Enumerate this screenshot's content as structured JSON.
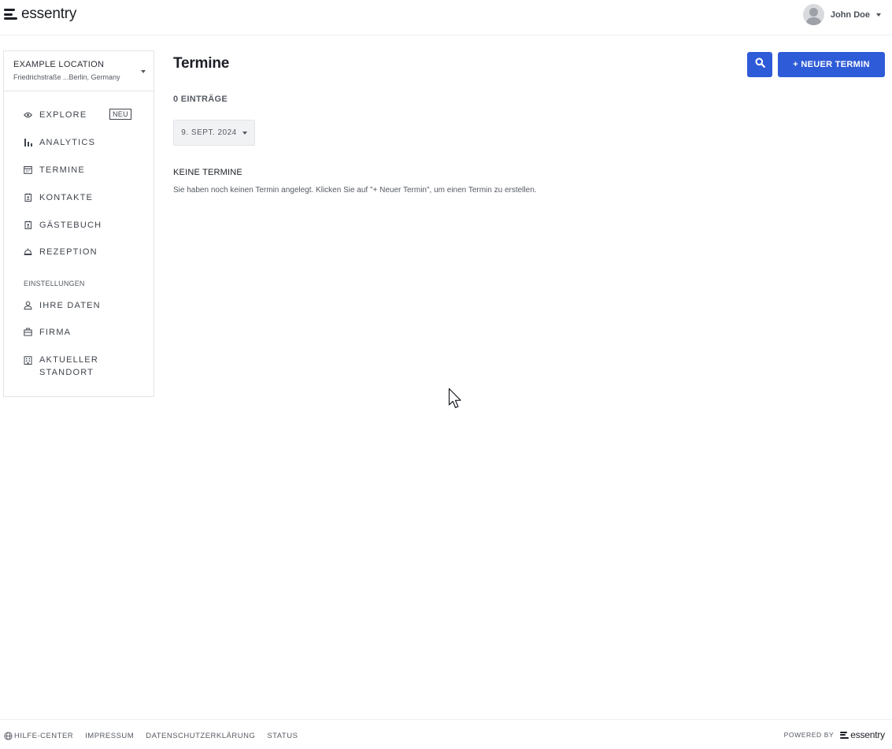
{
  "header": {
    "brand": "essentry",
    "user_name": "John Doe"
  },
  "location": {
    "name": "EXAMPLE LOCATION",
    "address": "Friedrichstraße ...Berlin, Germany"
  },
  "sidebar": {
    "items": [
      {
        "label": "EXPLORE",
        "icon": "eye-icon"
      },
      {
        "label": "ANALYTICS",
        "icon": "bar-chart-icon"
      },
      {
        "label": "TERMINE",
        "icon": "calendar-icon"
      },
      {
        "label": "KONTAKTE",
        "icon": "contact-book-icon"
      },
      {
        "label": "GÄSTEBUCH",
        "icon": "guestbook-icon"
      },
      {
        "label": "REZEPTION",
        "icon": "reception-bell-icon"
      }
    ],
    "new_badge": "NEU",
    "settings_label": "EINSTELLUNGEN",
    "settings_items": [
      {
        "label": "IHRE DATEN",
        "icon": "person-icon"
      },
      {
        "label": "FIRMA",
        "icon": "briefcase-icon"
      },
      {
        "label_line1": "AKTUELLER",
        "label_line2": "STANDORT",
        "icon": "building-icon"
      }
    ]
  },
  "main": {
    "title": "Termine",
    "count": "0 EINTRÄGE",
    "date": "9. SEPT. 2024",
    "empty_title": "KEINE TERMINE",
    "empty_text": "Sie haben noch keinen Termin angelegt. Klicken Sie auf \"+ Neuer Termin\", um einen Termin zu erstellen.",
    "new_button": "+ NEUER TERMIN"
  },
  "footer": {
    "links": [
      "HILFE-CENTER",
      "IMPRESSUM",
      "DATENSCHUTZERKLÄRUNG",
      "STATUS"
    ],
    "powered_by": "POWERED BY",
    "brand": "essentry"
  },
  "colors": {
    "accent": "#2e5bd8",
    "text": "#2b2f36",
    "border": "#e2e4e8"
  }
}
